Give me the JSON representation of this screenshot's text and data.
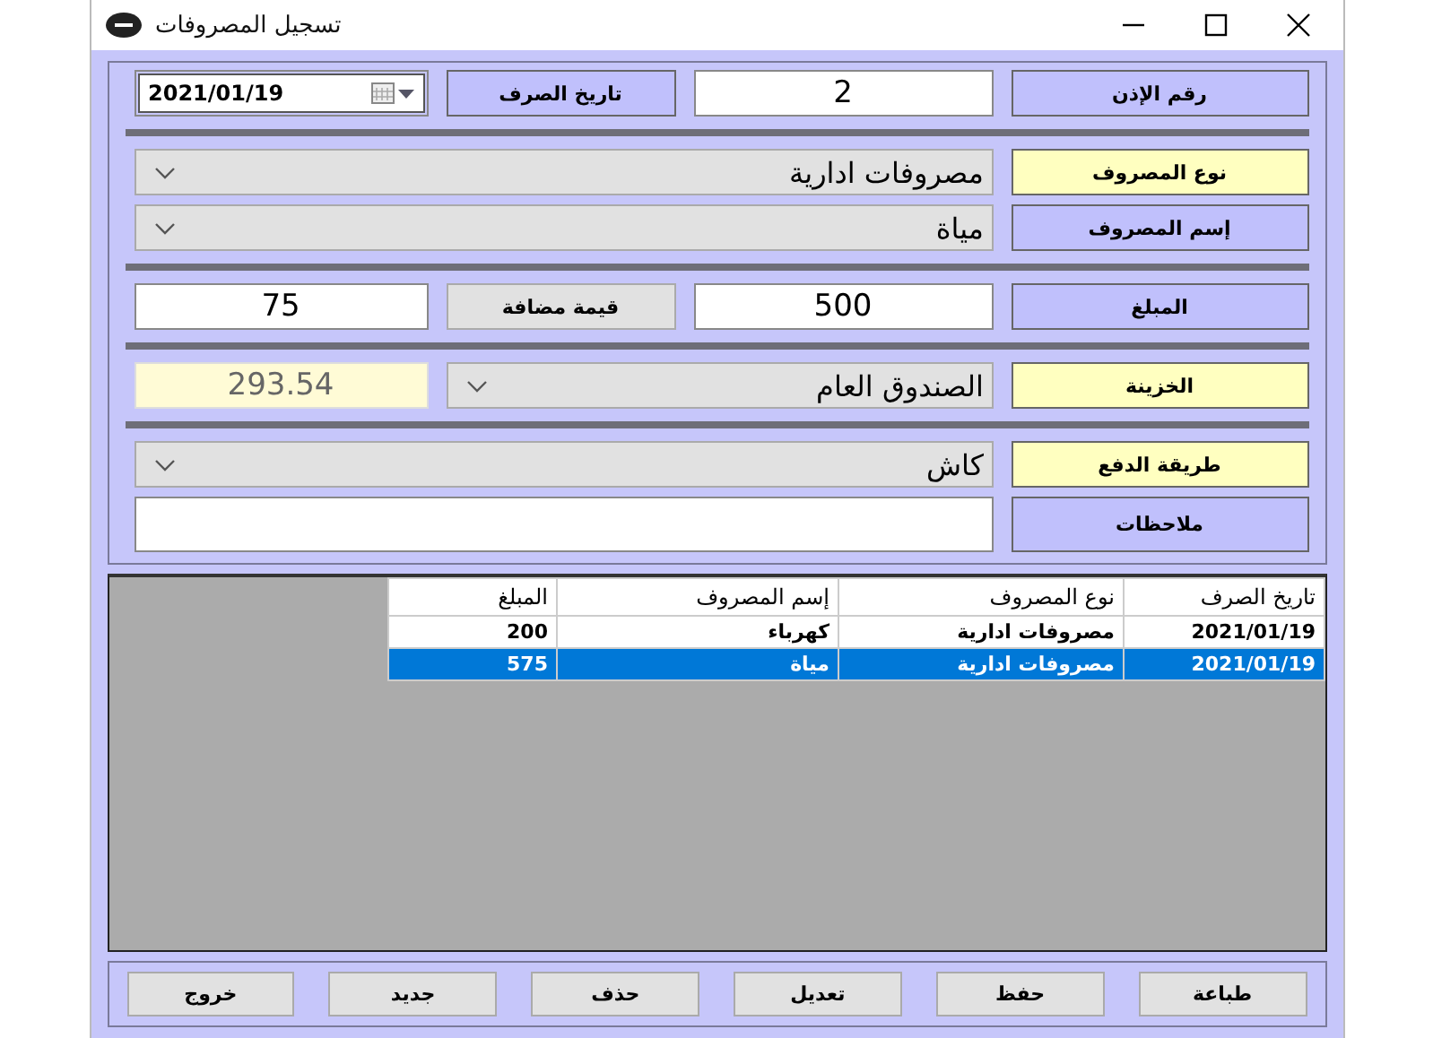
{
  "window": {
    "title": "تسجيل المصروفات"
  },
  "form": {
    "sections": [
      {
        "rows": [
          {
            "items": [
              {
                "kind": "label",
                "text": "رقم الإذن",
                "highlighted": false
              },
              {
                "kind": "text",
                "value": "2"
              },
              {
                "kind": "label",
                "text": "تاريخ الصرف",
                "highlighted": false
              },
              {
                "kind": "date",
                "value": "2021/01/19"
              }
            ]
          }
        ]
      },
      {
        "rows": [
          {
            "items": [
              {
                "kind": "label",
                "text": "نوع المصروف",
                "highlighted": true
              },
              {
                "kind": "combo",
                "value": "مصروفات ادارية"
              }
            ]
          },
          {
            "items": [
              {
                "kind": "label",
                "text": "إسم المصروف",
                "highlighted": false
              },
              {
                "kind": "combo",
                "value": "مياة"
              }
            ]
          }
        ]
      },
      {
        "rows": [
          {
            "items": [
              {
                "kind": "label",
                "text": "المبلغ",
                "highlighted": false
              },
              {
                "kind": "text",
                "value": "500"
              },
              {
                "kind": "button",
                "text": "قيمة مضافة"
              },
              {
                "kind": "text",
                "value": "75"
              }
            ]
          }
        ]
      },
      {
        "rows": [
          {
            "items": [
              {
                "kind": "label",
                "text": "الخزينة",
                "highlighted": true
              },
              {
                "kind": "combo",
                "value": "الصندوق العام"
              },
              {
                "kind": "readonly",
                "value": "293.54"
              }
            ]
          }
        ]
      },
      {
        "rows": [
          {
            "items": [
              {
                "kind": "label",
                "text": "طريقة الدفع",
                "highlighted": true
              },
              {
                "kind": "combo",
                "value": "كاش"
              }
            ]
          },
          {
            "items": [
              {
                "kind": "label",
                "text": "ملاحظات",
                "highlighted": false
              },
              {
                "kind": "memo"
              }
            ]
          }
        ]
      }
    ]
  },
  "table": {
    "columns": [
      "تاريخ الصرف",
      "نوع المصروف",
      "إسم المصروف",
      "المبلغ"
    ],
    "rows": [
      {
        "cells": [
          "2021/01/19",
          "مصروفات ادارية",
          "كهرباء",
          "200"
        ],
        "selected": false
      },
      {
        "cells": [
          "2021/01/19",
          "مصروفات ادارية",
          "مياة",
          "575"
        ],
        "selected": true
      }
    ]
  },
  "buttons": [
    "طباعة",
    "حفظ",
    "تعديل",
    "حذف",
    "جديد",
    "خروج"
  ]
}
